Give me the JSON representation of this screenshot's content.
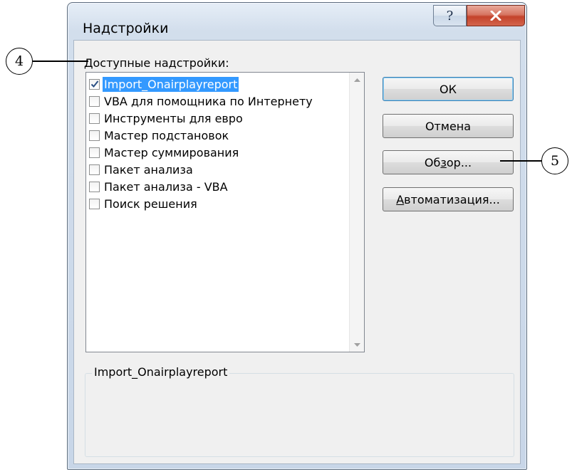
{
  "window": {
    "title": "Надстройки"
  },
  "titlebar": {
    "help_label": "?",
    "close_label": "x"
  },
  "available": {
    "label_prefix": "Д",
    "label_rest": "оступные надстройки:",
    "items": [
      {
        "label": "Import_Onairplayreport",
        "checked": true,
        "selected": true
      },
      {
        "label": "VBA для помощника по Интернету",
        "checked": false
      },
      {
        "label": "Инструменты для евро",
        "checked": false
      },
      {
        "label": "Мастер подстановок",
        "checked": false
      },
      {
        "label": "Мастер суммирования",
        "checked": false
      },
      {
        "label": "Пакет анализа",
        "checked": false
      },
      {
        "label": "Пакет анализа - VBA",
        "checked": false
      },
      {
        "label": "Поиск решения",
        "checked": false
      }
    ]
  },
  "buttons": {
    "ok": "ОК",
    "cancel": "Отмена",
    "browse_pre": "Об",
    "browse_u": "з",
    "browse_post": "ор...",
    "auto_u": "А",
    "auto_post": "втоматизация..."
  },
  "description": {
    "caption": "Import_Onairplayreport"
  },
  "callouts": {
    "left": "4",
    "right": "5"
  }
}
